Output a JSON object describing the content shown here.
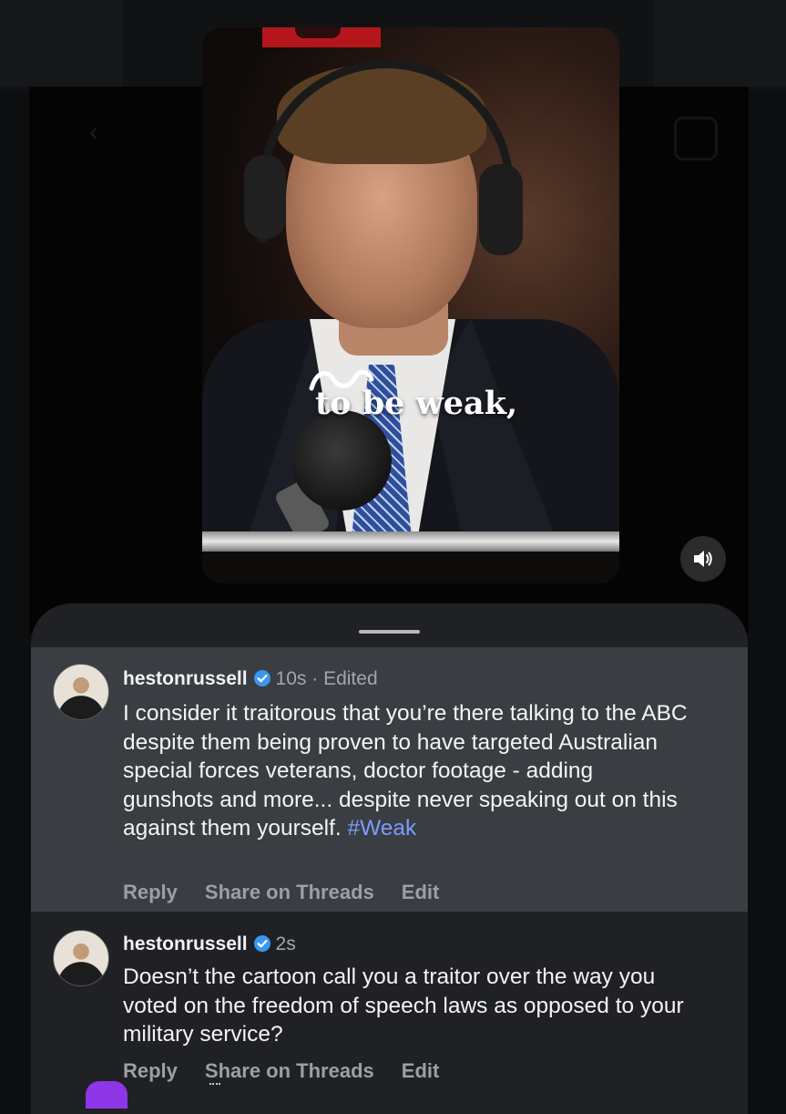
{
  "video": {
    "caption": "to be weak,"
  },
  "comments": [
    {
      "username": "hestonrussell",
      "time": "10s",
      "edited": "· Edited",
      "text": "I consider it traitorous that you’re there talking to the ABC despite them being proven to have targeted Australian special forces veterans, doctor footage - adding gunshots and more... despite never speaking out on this against them yourself.",
      "hashtag": "#Weak",
      "actions": {
        "reply": "Reply",
        "share": "Share on Threads",
        "edit": "Edit"
      }
    },
    {
      "username": "hestonrussell",
      "time": "2s",
      "text": "Doesn’t the cartoon call you a traitor over the way you voted on the freedom of speech laws as opposed to your military service?",
      "actions": {
        "reply": "Reply",
        "share": "Share on Threads",
        "edit": "Edit"
      }
    }
  ],
  "colors": {
    "verified": "#3897f0",
    "hashtag": "#7b9cff",
    "highlight_row": "#3a3d42",
    "sheet": "#1f2124"
  },
  "icons": [
    "back-arrow-icon",
    "camera-icon",
    "abc-logo-icon",
    "volume-icon",
    "verified-badge-icon",
    "heart-reaction-icon"
  ]
}
